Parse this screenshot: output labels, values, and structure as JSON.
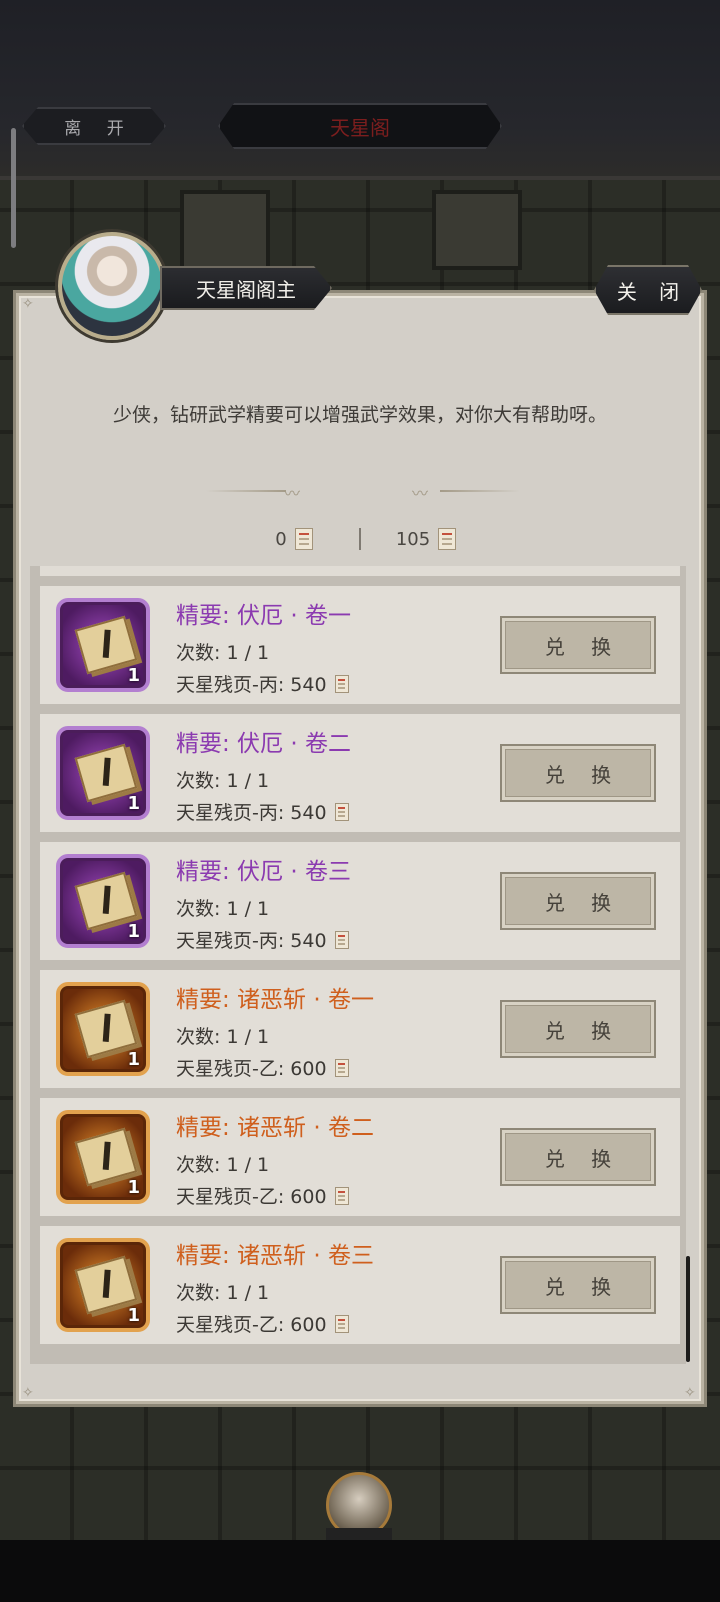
{
  "header": {
    "leave_label": "离 开",
    "title": "天星阁"
  },
  "npc": {
    "name": "天星阁阁主",
    "dialog": "少侠，钻研武学精要可以增强武学效果，对你大有帮助呀。"
  },
  "close_label": "关 闭",
  "currencies": [
    {
      "amount": "0",
      "icon": "page-icon"
    },
    {
      "amount": "105",
      "icon": "page-icon"
    }
  ],
  "exchange_label": "兑 换",
  "items": [
    {
      "name": "精要: 伏厄 · 卷一",
      "times": "次数: 1 / 1",
      "cost": "天星残页-丙: 540",
      "count": "1",
      "rarity": "purple",
      "color": "#8b3ab0"
    },
    {
      "name": "精要: 伏厄 · 卷二",
      "times": "次数: 1 / 1",
      "cost": "天星残页-丙: 540",
      "count": "1",
      "rarity": "purple",
      "color": "#8b3ab0"
    },
    {
      "name": "精要: 伏厄 · 卷三",
      "times": "次数: 1 / 1",
      "cost": "天星残页-丙: 540",
      "count": "1",
      "rarity": "purple",
      "color": "#8b3ab0"
    },
    {
      "name": "精要: 诸恶斩 · 卷一",
      "times": "次数: 1 / 1",
      "cost": "天星残页-乙: 600",
      "count": "1",
      "rarity": "orange",
      "color": "#cf5f1d"
    },
    {
      "name": "精要: 诸恶斩 · 卷二",
      "times": "次数: 1 / 1",
      "cost": "天星残页-乙: 600",
      "count": "1",
      "rarity": "orange",
      "color": "#cf5f1d"
    },
    {
      "name": "精要: 诸恶斩 · 卷三",
      "times": "次数: 1 / 1",
      "cost": "天星残页-乙: 600",
      "count": "1",
      "rarity": "orange",
      "color": "#cf5f1d"
    }
  ]
}
